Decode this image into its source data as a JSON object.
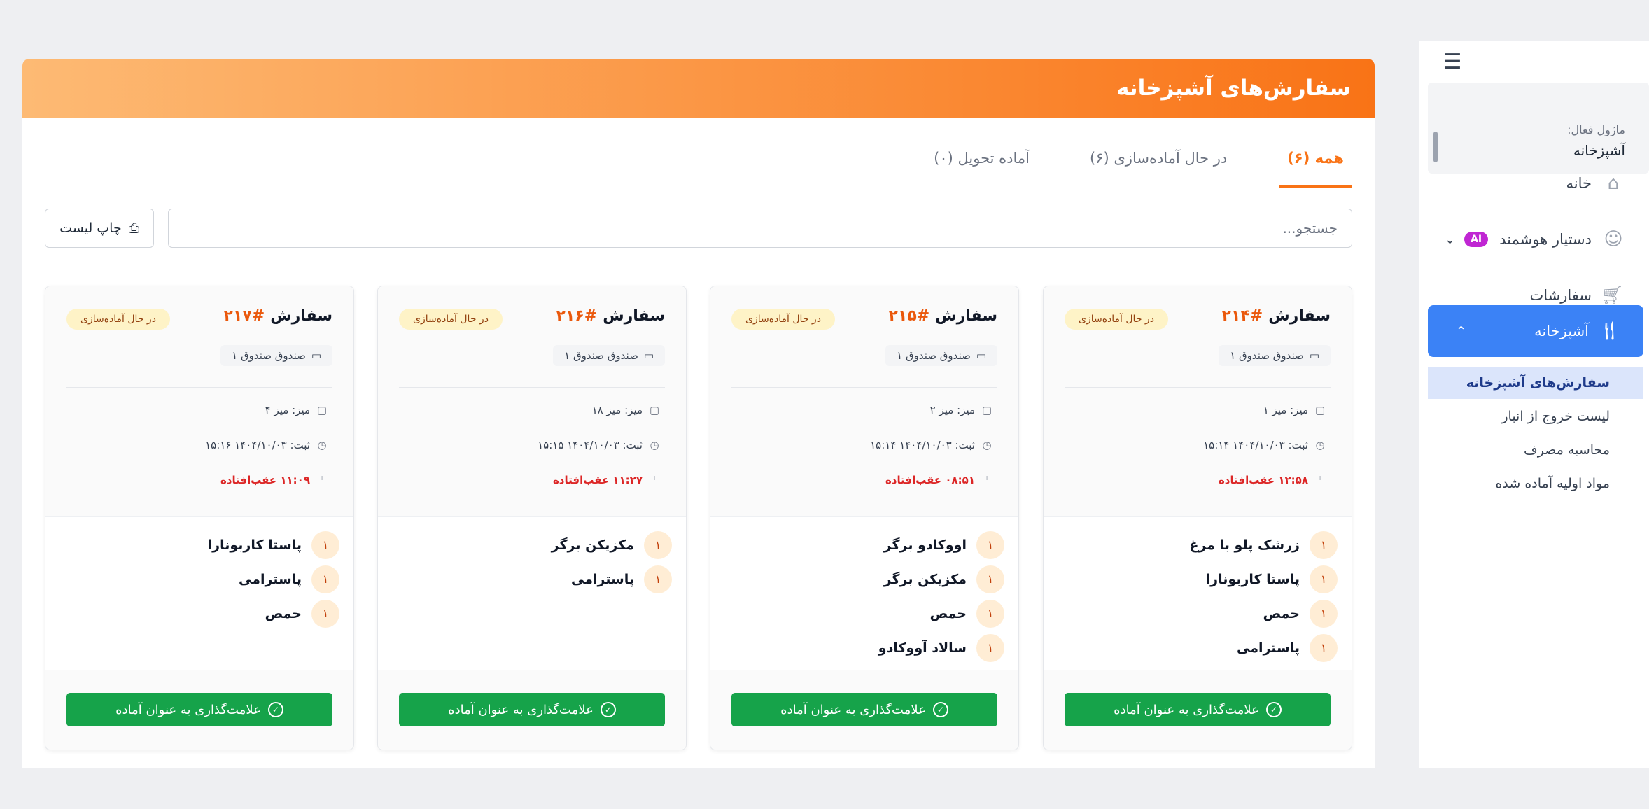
{
  "sidebar": {
    "module_label": "ماژول فعال:",
    "module_value": "آشپزخانه",
    "items": [
      {
        "label": "خانه",
        "icon": "home-icon"
      },
      {
        "label": "دستیار هوشمند",
        "badge": "AI",
        "icon": "robot-icon"
      },
      {
        "label": "سفارشات",
        "icon": "cart-icon"
      },
      {
        "label": "آشپزخانه",
        "icon": "utensils-icon"
      }
    ],
    "subitems": [
      "سفارش‌های آشپزخانه",
      "لیست خروج از انبار",
      "محاسبه مصرف",
      "مواد اولیه آماده شده"
    ]
  },
  "header": {
    "title": "سفارش‌های آشپزخانه"
  },
  "tabs": [
    {
      "label": "همه (۶)"
    },
    {
      "label": "در حال آماده‌سازی (۶)"
    },
    {
      "label": "آماده تحویل (۰)"
    }
  ],
  "search": {
    "placeholder": "جستجو..."
  },
  "print": {
    "label": "چاپ لیست"
  },
  "colors": {
    "accent": "#f97316",
    "primary": "#3b82f6",
    "success": "#16a34a",
    "danger": "#dc2626"
  },
  "cards": [
    {
      "title": "سفارش",
      "number": "#۲۱۴",
      "status": "در حال آماده‌سازی",
      "register": "صندوق صندوق ۱",
      "table": "میز: میز ۱",
      "time": "ثبت: ۱۴۰۴/۱۰/۰۳ ۱۵:۱۴",
      "late": "۱۲:۵۸ عقب‌افتاده",
      "items": [
        {
          "qty": "۱",
          "name": "زرشک پلو با مرغ"
        },
        {
          "qty": "۱",
          "name": "پاستا کاربونارا"
        },
        {
          "qty": "۱",
          "name": "حمص"
        },
        {
          "qty": "۱",
          "name": "پاسترامی"
        }
      ],
      "button": "علامت‌گذاری به عنوان آماده"
    },
    {
      "title": "سفارش",
      "number": "#۲۱۵",
      "status": "در حال آماده‌سازی",
      "register": "صندوق صندوق ۱",
      "table": "میز: میز ۲",
      "time": "ثبت: ۱۴۰۴/۱۰/۰۳ ۱۵:۱۴",
      "late": "۰۸:۵۱ عقب‌افتاده",
      "items": [
        {
          "qty": "۱",
          "name": "اووکادو برگر"
        },
        {
          "qty": "۱",
          "name": "مکزیکن برگر"
        },
        {
          "qty": "۱",
          "name": "حمص"
        },
        {
          "qty": "۱",
          "name": "سالاد آووکادو"
        }
      ],
      "button": "علامت‌گذاری به عنوان آماده"
    },
    {
      "title": "سفارش",
      "number": "#۲۱۶",
      "status": "در حال آماده‌سازی",
      "register": "صندوق صندوق ۱",
      "table": "میز: میز ۱۸",
      "time": "ثبت: ۱۴۰۴/۱۰/۰۳ ۱۵:۱۵",
      "late": "۱۱:۲۷ عقب‌افتاده",
      "items": [
        {
          "qty": "۱",
          "name": "مکزیکن برگر"
        },
        {
          "qty": "۱",
          "name": "پاسترامی"
        }
      ],
      "button": "علامت‌گذاری به عنوان آماده"
    },
    {
      "title": "سفارش",
      "number": "#۲۱۷",
      "status": "در حال آماده‌سازی",
      "register": "صندوق صندوق ۱",
      "table": "میز: میز ۴",
      "time": "ثبت: ۱۴۰۴/۱۰/۰۳ ۱۵:۱۶",
      "late": "۱۱:۰۹ عقب‌افتاده",
      "items": [
        {
          "qty": "۱",
          "name": "پاستا کاربونارا"
        },
        {
          "qty": "۱",
          "name": "پاسترامی"
        },
        {
          "qty": "۱",
          "name": "حمص"
        }
      ],
      "button": "علامت‌گذاری به عنوان آماده"
    }
  ]
}
